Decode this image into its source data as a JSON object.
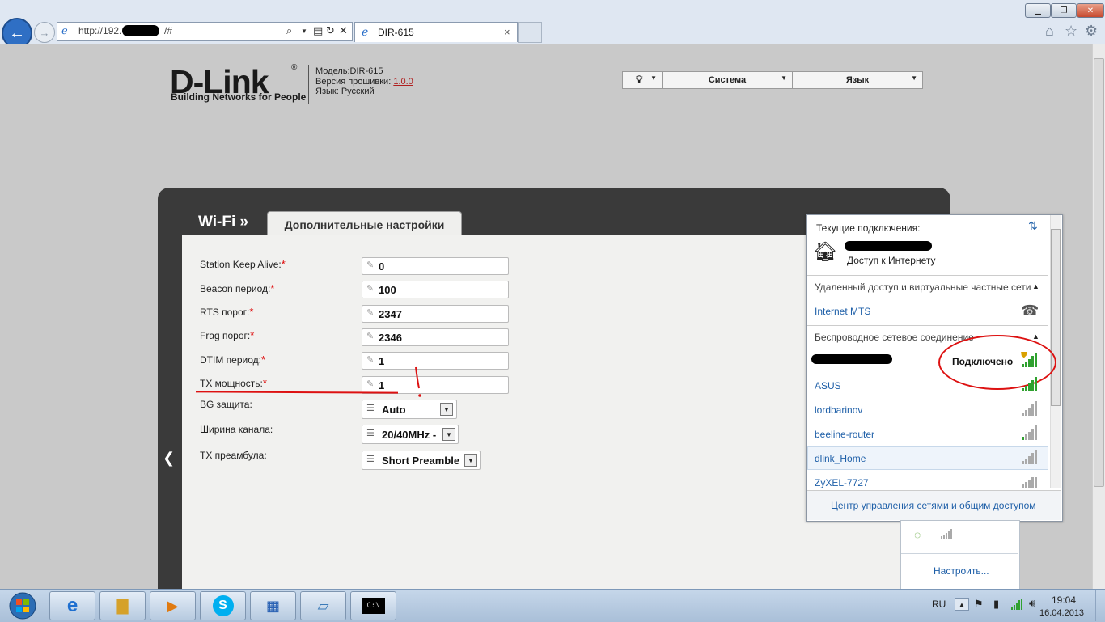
{
  "browser": {
    "address_prefix": "http://192.",
    "address_suffix": "/#",
    "tab_title": "DIR-615",
    "tab_close": "×"
  },
  "header": {
    "logo": "D-Link",
    "logo_tagline": "Building Networks for People",
    "model_label": "Модель:",
    "model_value": "DIR-615",
    "firmware_label": "Версия прошивки:",
    "firmware_value": "1.0.0",
    "language_label": "Язык:",
    "language_value": "Русский"
  },
  "topmenu": {
    "system_label": "Система",
    "language_label": "Язык"
  },
  "panel": {
    "section_title": "Wi-Fi »",
    "tab_label": "Дополнительные настройки"
  },
  "fields": [
    {
      "label": "Station Keep Alive:",
      "value": "0"
    },
    {
      "label": "Beacon период:",
      "value": "100"
    },
    {
      "label": "RTS порог:",
      "value": "2347"
    },
    {
      "label": "Frag порог:",
      "value": "2346"
    },
    {
      "label": "DTIM период:",
      "value": "1"
    },
    {
      "label": "TX мощность:",
      "value": "1"
    }
  ],
  "required_mark": "*",
  "selects": [
    {
      "label": "BG защита:",
      "value": "Auto"
    },
    {
      "label": "Ширина канала:",
      "value": "20/40MHz -"
    },
    {
      "label": "TX преамбула:",
      "value": "Short Preamble"
    }
  ],
  "network_flyout": {
    "current_connections": "Текущие подключения:",
    "internet_access": "Доступ к Интернету",
    "vpn_section": "Удаленный доступ и виртуальные частные сети",
    "vpn_item": "Internet MTS",
    "wireless_section": "Беспроводное сетевое соединение",
    "connected_status": "Подключено",
    "networks": [
      "ASUS",
      "lordbarinov",
      "beeline-router",
      "dlink_Home",
      "ZyXEL-7727"
    ],
    "footer_link": "Центр управления сетями и общим доступом"
  },
  "settings_box": {
    "configure_link": "Настроить..."
  },
  "taskbar": {
    "language": "RU",
    "time": "19:04",
    "date": "16.04.2013"
  },
  "colors": {
    "panel_dark": "#3a3a3a",
    "required": "#dd0000",
    "link_blue": "#1e5fa8",
    "signal_green": "#2fa12f",
    "annotation_red": "#dd1111"
  }
}
